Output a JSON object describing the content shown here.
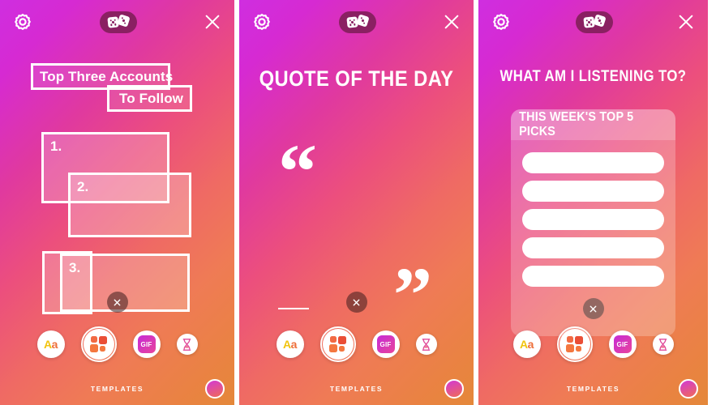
{
  "app": {
    "bottom_label": "TEMPLATES",
    "icons": {
      "settings": "gear-icon",
      "close": "close-icon",
      "shuffle": "dice-icon",
      "text": "Aa",
      "gif": "GIF",
      "timer": "hourglass-icon",
      "templates": "templates-grid-icon",
      "avatar": "avatar-icon",
      "dismiss": "close-x-icon"
    },
    "colors": {
      "gradient_start": "#cf2ee0",
      "gradient_mid": "#ec4f7d",
      "gradient_end": "#e4883a",
      "dice_pill": "#8a2062",
      "gif_chip_start": "#c62bd6",
      "gif_chip_end": "#e8449b",
      "template_orange": "#f26a43",
      "white": "#ffffff"
    }
  },
  "panels": [
    {
      "id": "top-three-accounts",
      "name": "Top Three Accounts To Follow",
      "headline_lines": [
        "Top Three Accounts",
        "To Follow"
      ],
      "entries": [
        "1.",
        "2.",
        "3."
      ]
    },
    {
      "id": "quote-of-the-day",
      "name": "Quote of the Day",
      "title": "QUOTE OF THE DAY",
      "quote_open": "“",
      "quote_close": "”"
    },
    {
      "id": "what-am-i-listening-to",
      "name": "What Am I Listening To",
      "title": "WHAT AM I LISTENING TO?",
      "card_title": "THIS WEEK'S TOP 5 PICKS",
      "rows": [
        "",
        "",
        "",
        "",
        ""
      ]
    }
  ]
}
